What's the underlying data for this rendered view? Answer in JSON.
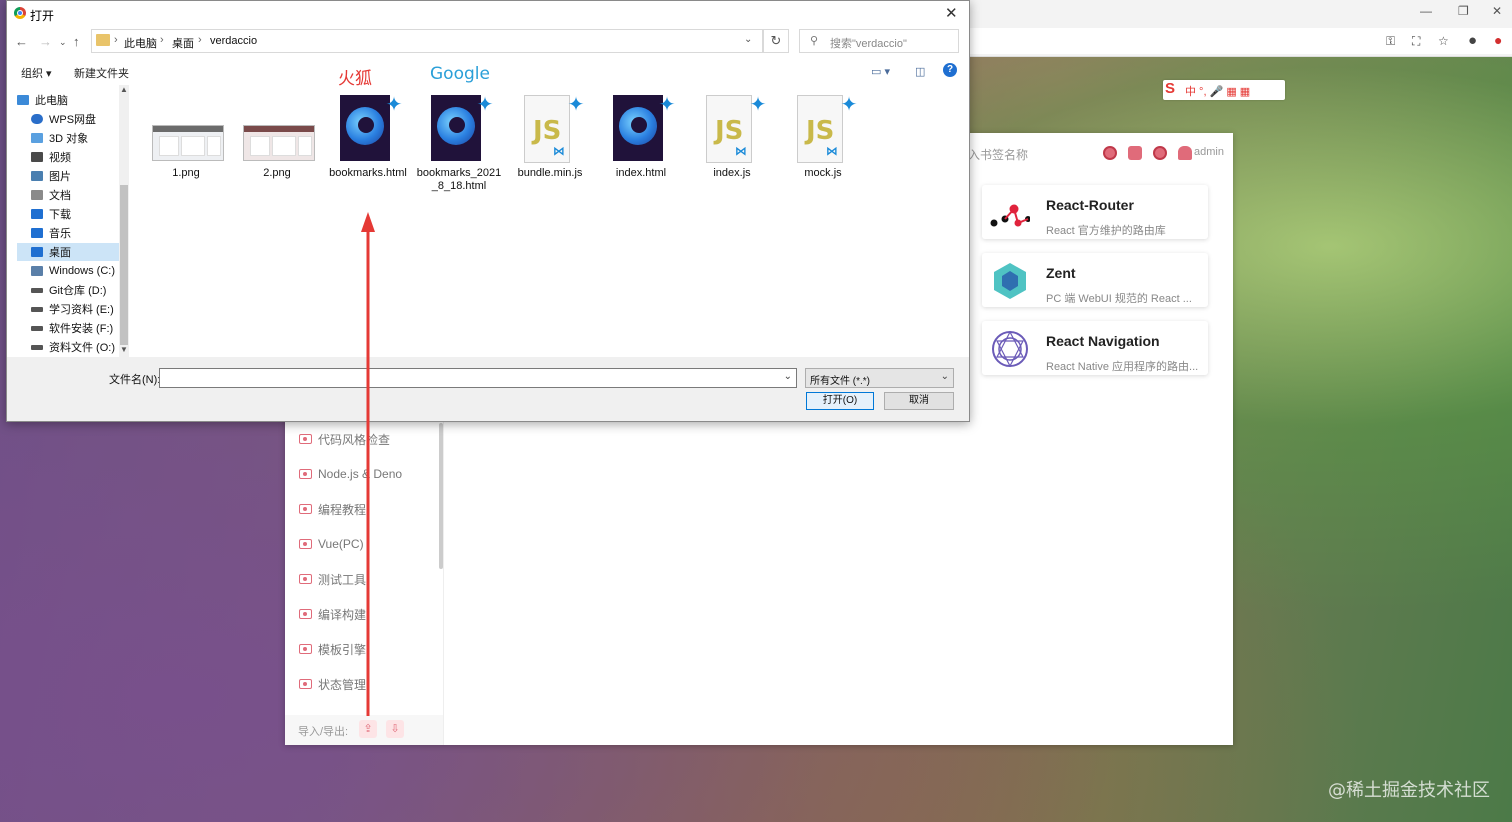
{
  "dialog": {
    "title": "打开",
    "breadcrumb": [
      "此电脑",
      "桌面",
      "verdaccio"
    ],
    "search_placeholder": "搜索\"verdaccio\"",
    "toolbar": {
      "organize": "组织 ▾",
      "new_folder": "新建文件夹"
    },
    "nav_items": [
      {
        "label": "此电脑",
        "icon": "computer-icon",
        "color": "#3c8ad8"
      },
      {
        "label": "WPS网盘",
        "icon": "cloud-icon",
        "color": "#2a6ec9"
      },
      {
        "label": "3D 对象",
        "icon": "cube-icon",
        "color": "#5aa0e0"
      },
      {
        "label": "视频",
        "icon": "video-icon",
        "color": "#4a4a4a"
      },
      {
        "label": "图片",
        "icon": "pictures-icon",
        "color": "#4a7fb0"
      },
      {
        "label": "文档",
        "icon": "documents-icon",
        "color": "#8a8a8a"
      },
      {
        "label": "下载",
        "icon": "download-icon",
        "color": "#1f6fd1"
      },
      {
        "label": "音乐",
        "icon": "music-icon",
        "color": "#1f6fd1"
      },
      {
        "label": "桌面",
        "icon": "desktop-icon",
        "color": "#1f6fd1"
      },
      {
        "label": "Windows (C:)",
        "icon": "drive-icon",
        "color": "#5a7fa8"
      },
      {
        "label": "Git仓库 (D:)",
        "icon": "drive-icon",
        "color": "#555"
      },
      {
        "label": "学习资料 (E:)",
        "icon": "drive-icon",
        "color": "#555"
      },
      {
        "label": "软件安装 (F:)",
        "icon": "drive-icon",
        "color": "#555"
      },
      {
        "label": "资料文件 (O:)",
        "icon": "drive-icon",
        "color": "#555"
      }
    ],
    "files": [
      {
        "name": "1.png",
        "type": "png"
      },
      {
        "name": "2.png",
        "type": "png"
      },
      {
        "name": "bookmarks.html",
        "type": "firefox"
      },
      {
        "name": "bookmarks_2021_8_18.html",
        "type": "firefox"
      },
      {
        "name": "bundle.min.js",
        "type": "js"
      },
      {
        "name": "index.html",
        "type": "firefox"
      },
      {
        "name": "index.js",
        "type": "js"
      },
      {
        "name": "mock.js",
        "type": "js"
      }
    ],
    "filename_label": "文件名(N):",
    "filename_value": "",
    "filetype": "所有文件 (*.*)",
    "open_button": "打开(O)",
    "cancel_button": "取消"
  },
  "annotations": {
    "firefox_label": "火狐",
    "google_label": "Google",
    "arrow_color": "#e53935"
  },
  "app": {
    "search_placeholder": "入书签名称",
    "user": "admin",
    "sidebar_items": [
      "代码风格检查",
      "Node.js & Deno",
      "编程教程",
      "Vue(PC)",
      "测试工具",
      "编译构建",
      "模板引擎",
      "状态管理"
    ],
    "import_export_label": "导入/导出:",
    "cards": [
      {
        "title": "React-Router",
        "desc": "React 官方维护的路由库"
      },
      {
        "title": "Zent",
        "desc": "PC 端 WebUI 规范的 React ..."
      },
      {
        "title": "React Navigation",
        "desc": "React Native 应用程序的路由..."
      }
    ],
    "accent": "#e06b7a"
  },
  "watermark": "@稀土掘金技术社区"
}
